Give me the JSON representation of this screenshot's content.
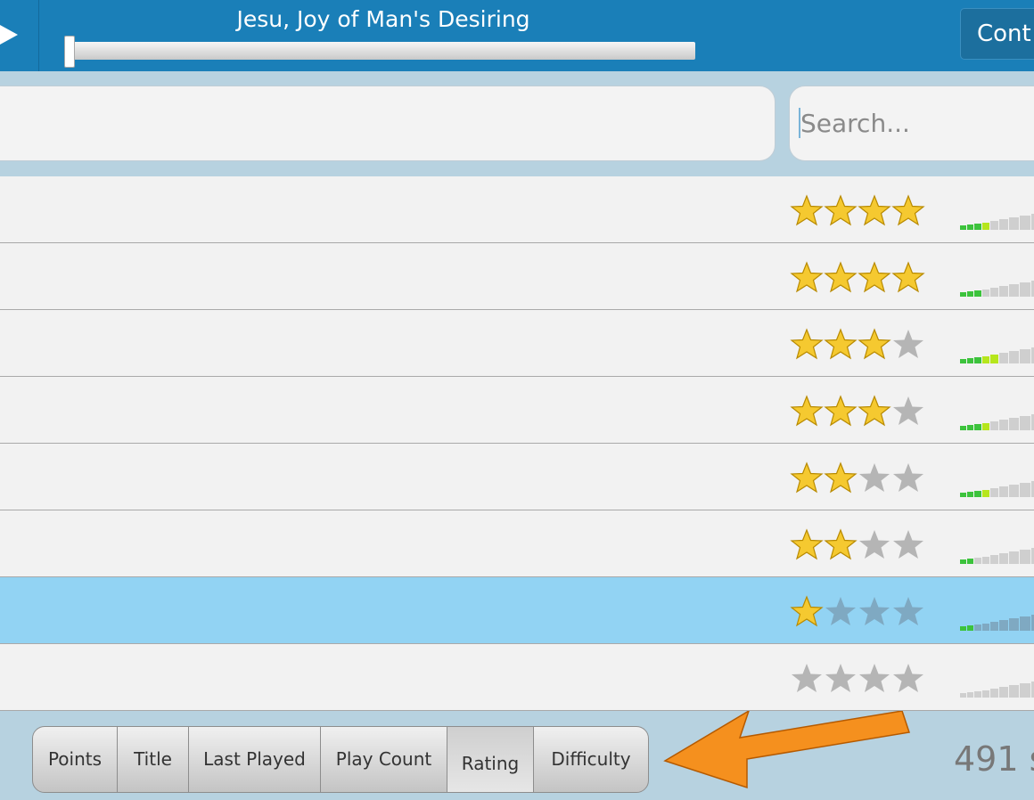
{
  "header": {
    "song_title": "Jesu, Joy of Man's Desiring",
    "progress": 0.0,
    "right_button_label": "Cont"
  },
  "search": {
    "placeholder": "Search..."
  },
  "songs": [
    {
      "rating": 4,
      "difficulty_green": 4
    },
    {
      "rating": 4,
      "difficulty_green": 3
    },
    {
      "rating": 3,
      "difficulty_green": 5
    },
    {
      "rating": 3,
      "difficulty_green": 4
    },
    {
      "rating": 2,
      "difficulty_green": 4
    },
    {
      "rating": 2,
      "difficulty_green": 2
    },
    {
      "rating": 1,
      "difficulty_green": 2,
      "selected": true
    },
    {
      "rating": 0,
      "difficulty_green": 0
    }
  ],
  "sort": {
    "buttons": [
      "Points",
      "Title",
      "Last Played",
      "Play Count",
      "Rating",
      "Difficulty"
    ],
    "active": "Rating"
  },
  "footer": {
    "count_text": "491 s"
  },
  "colors": {
    "header_bg": "#1a7fb8",
    "page_bg": "#b7d2e0",
    "row_bg": "#f2f2f2",
    "selected_row_bg": "#92d3f3",
    "star_gold": "#f5c930",
    "star_gray": "#b5b5b5",
    "meter_green": "#3cc33c",
    "meter_lime": "#b6e61c",
    "arrow": "#f5901e"
  },
  "icons": {
    "play": "play-icon",
    "star": "star-icon",
    "difficulty": "difficulty-meter-icon",
    "arrow": "arrow-icon"
  }
}
